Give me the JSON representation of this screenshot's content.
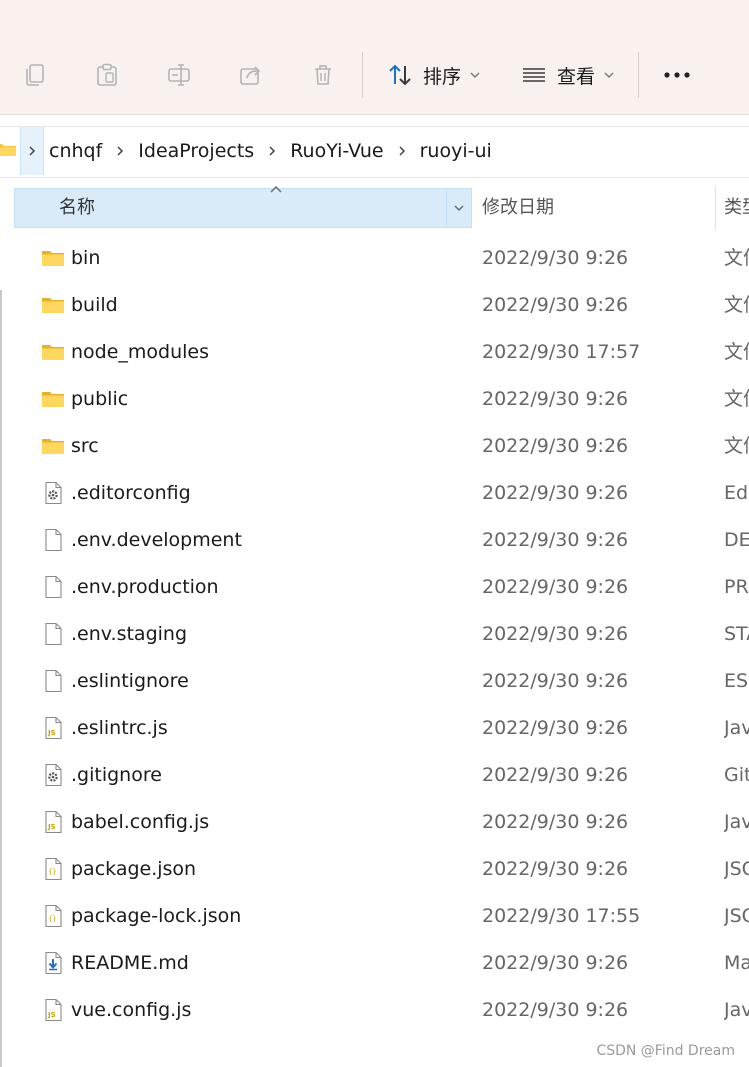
{
  "toolbar": {
    "sort_label": "排序",
    "view_label": "查看",
    "colors": {
      "background": "#f9f1ed",
      "accent": "#1a73c8"
    }
  },
  "address": {
    "crumbs": [
      "cnhqf",
      "IdeaProjects",
      "RuoYi-Vue",
      "ruoyi-ui"
    ]
  },
  "columns": {
    "name": "名称",
    "date": "修改日期",
    "type": "类型"
  },
  "files": [
    {
      "name": "bin",
      "date": "2022/9/30 9:26",
      "type": "文件夹",
      "icon": "folder-icon"
    },
    {
      "name": "build",
      "date": "2022/9/30 9:26",
      "type": "文件夹",
      "icon": "folder-icon"
    },
    {
      "name": "node_modules",
      "date": "2022/9/30 17:57",
      "type": "文件夹",
      "icon": "folder-icon"
    },
    {
      "name": "public",
      "date": "2022/9/30 9:26",
      "type": "文件夹",
      "icon": "folder-icon"
    },
    {
      "name": "src",
      "date": "2022/9/30 9:26",
      "type": "文件夹",
      "icon": "folder-icon"
    },
    {
      "name": ".editorconfig",
      "date": "2022/9/30 9:26",
      "type": "Editor",
      "icon": "gear-file-icon"
    },
    {
      "name": ".env.development",
      "date": "2022/9/30 9:26",
      "type": "DEV",
      "icon": "blank-file-icon"
    },
    {
      "name": ".env.production",
      "date": "2022/9/30 9:26",
      "type": "PRO",
      "icon": "blank-file-icon"
    },
    {
      "name": ".env.staging",
      "date": "2022/9/30 9:26",
      "type": "STA",
      "icon": "blank-file-icon"
    },
    {
      "name": ".eslintignore",
      "date": "2022/9/30 9:26",
      "type": "ESL",
      "icon": "blank-file-icon"
    },
    {
      "name": ".eslintrc.js",
      "date": "2022/9/30 9:26",
      "type": "Java",
      "icon": "js-file-icon"
    },
    {
      "name": ".gitignore",
      "date": "2022/9/30 9:26",
      "type": "Git",
      "icon": "gear-file-icon"
    },
    {
      "name": "babel.config.js",
      "date": "2022/9/30 9:26",
      "type": "Java",
      "icon": "js-file-icon"
    },
    {
      "name": "package.json",
      "date": "2022/9/30 9:26",
      "type": "JSO",
      "icon": "json-file-icon"
    },
    {
      "name": "package-lock.json",
      "date": "2022/9/30 17:55",
      "type": "JSO",
      "icon": "json-file-icon"
    },
    {
      "name": "README.md",
      "date": "2022/9/30 9:26",
      "type": "Mar",
      "icon": "md-file-icon"
    },
    {
      "name": "vue.config.js",
      "date": "2022/9/30 9:26",
      "type": "Java",
      "icon": "js-file-icon"
    }
  ],
  "watermark": "CSDN @Find Dream"
}
